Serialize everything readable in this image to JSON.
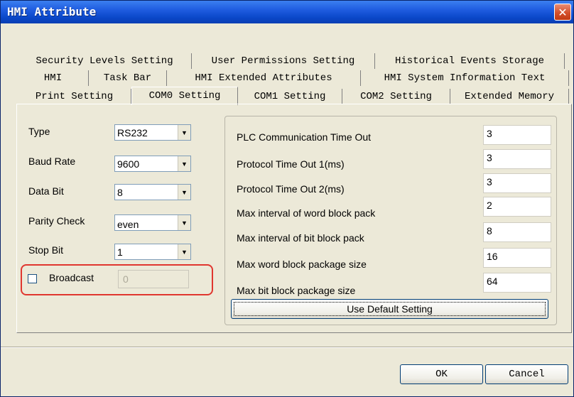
{
  "window": {
    "title": "HMI Attribute",
    "close_glyph": "✕"
  },
  "tabs": {
    "row1": [
      "Security Levels Setting",
      "User Permissions Setting",
      "Historical Events Storage"
    ],
    "row2": [
      "HMI",
      "Task Bar",
      "HMI Extended Attributes",
      "HMI System Information Text"
    ],
    "row3": [
      "Print Setting",
      "COM0 Setting",
      "COM1 Setting",
      "COM2 Setting",
      "Extended Memory"
    ],
    "active": "COM0 Setting"
  },
  "com": {
    "type": {
      "label": "Type",
      "value": "RS232"
    },
    "baud": {
      "label": "Baud Rate",
      "value": "9600"
    },
    "databit": {
      "label": "Data Bit",
      "value": "8"
    },
    "parity": {
      "label": "Parity Check",
      "value": "even"
    },
    "stopbit": {
      "label": "Stop Bit",
      "value": "1"
    },
    "broadcast": {
      "label": "Broadcast",
      "checked": false,
      "value": "0"
    }
  },
  "timeouts": {
    "plc": {
      "label": "PLC Communication Time Out",
      "value": "3"
    },
    "proto1": {
      "label": "Protocol Time Out 1(ms)",
      "value": "3"
    },
    "proto2": {
      "label": "Protocol Time Out 2(ms)",
      "value": "3"
    },
    "word_interval": {
      "label": "Max interval of word block pack",
      "value": "2"
    },
    "bit_interval": {
      "label": "Max interval of bit block pack",
      "value": "8"
    },
    "word_size": {
      "label": "Max word block package size",
      "value": "16"
    },
    "bit_size": {
      "label": "Max bit block package size",
      "value": "64"
    },
    "default_button": "Use Default Setting"
  },
  "buttons": {
    "ok": "OK",
    "cancel": "Cancel"
  },
  "colors": {
    "highlight": "#e0362f",
    "titlebar": "#0a47c8"
  },
  "icons": {
    "close": "close-icon",
    "dropdown": "chevron-down-icon"
  }
}
